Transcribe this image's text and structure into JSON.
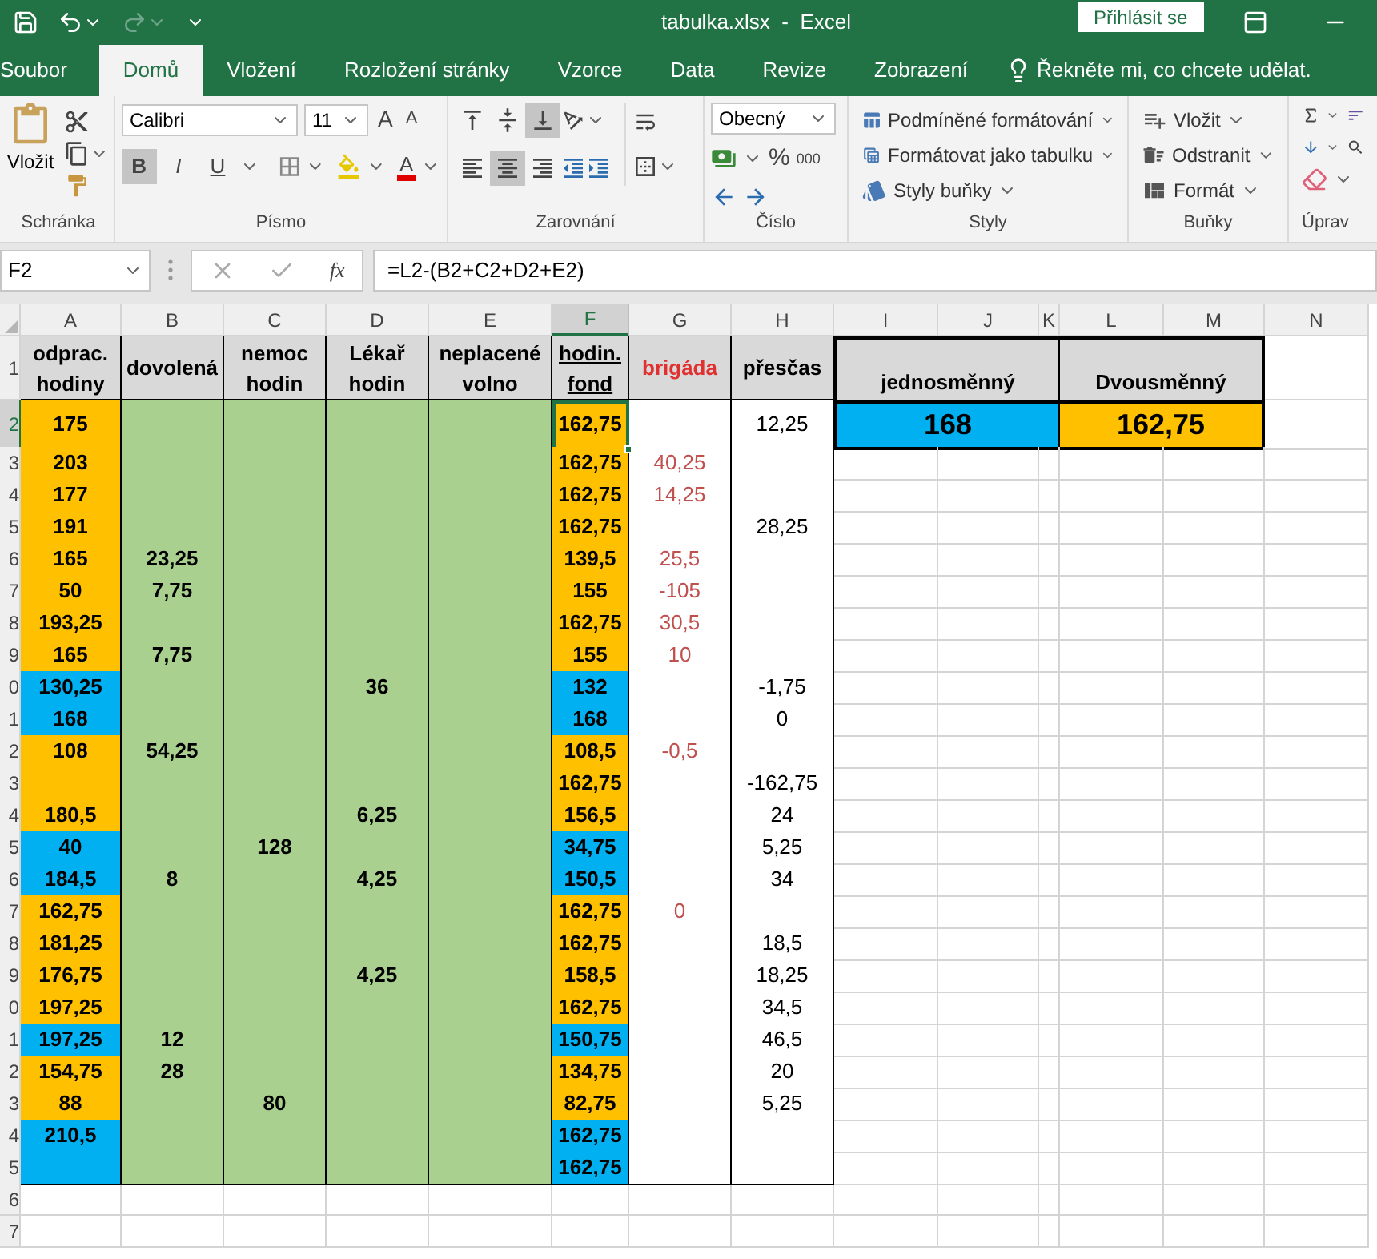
{
  "title_bar": {
    "title": "tabulka.xlsx  -  Excel",
    "sign_in": "Přihlásit se"
  },
  "tabs": [
    {
      "label": "Soubor",
      "selected": false
    },
    {
      "label": "Domů",
      "selected": true
    },
    {
      "label": "Vložení",
      "selected": false
    },
    {
      "label": "Rozložení stránky",
      "selected": false
    },
    {
      "label": "Vzorce",
      "selected": false
    },
    {
      "label": "Data",
      "selected": false
    },
    {
      "label": "Revize",
      "selected": false
    },
    {
      "label": "Zobrazení",
      "selected": false
    }
  ],
  "tell_me": "Řekněte mi, co chcete udělat.",
  "ribbon": {
    "clipboard": {
      "paste": "Vložit",
      "label": "Schránka"
    },
    "font": {
      "name": "Calibri",
      "size": "11",
      "grow": "A",
      "shrink": "A",
      "styles": [
        {
          "label": "B",
          "selected": true
        },
        {
          "label": "I",
          "selected": false
        },
        {
          "label": "U",
          "selected": false
        }
      ],
      "font_color": "A",
      "label": "Písmo"
    },
    "alignment": {
      "vertical": [
        {
          "kind": "top",
          "selected": false
        },
        {
          "kind": "middle",
          "selected": false
        },
        {
          "kind": "bottom",
          "selected": true
        }
      ],
      "horizontal": [
        {
          "kind": "left",
          "selected": false
        },
        {
          "kind": "center",
          "selected": true
        },
        {
          "kind": "right",
          "selected": false
        }
      ],
      "label": "Zarovnání"
    },
    "number": {
      "format": "Obecný",
      "percent": "%",
      "thousands": "000",
      "label": "Číslo"
    },
    "styles": {
      "items": [
        "Podmíněné formátování",
        "Formátovat jako tabulku",
        "Styly buňky"
      ],
      "label": "Styly"
    },
    "cells": {
      "items": [
        "Vložit",
        "Odstranit",
        "Formát"
      ],
      "label": "Buňky"
    },
    "editing": {
      "label": "Úprav"
    }
  },
  "formula_bar": {
    "name_box": "F2",
    "function_button": "fx",
    "formula": "=L2-(B2+C2+D2+E2)"
  },
  "columns": [
    {
      "label": "A",
      "selected": false
    },
    {
      "label": "B",
      "selected": false
    },
    {
      "label": "C",
      "selected": false
    },
    {
      "label": "D",
      "selected": false
    },
    {
      "label": "E",
      "selected": false
    },
    {
      "label": "F",
      "selected": true
    },
    {
      "label": "G",
      "selected": false
    },
    {
      "label": "H",
      "selected": false
    },
    {
      "label": "I",
      "selected": false
    },
    {
      "label": "J",
      "selected": false
    },
    {
      "label": "K",
      "selected": false
    },
    {
      "label": "L",
      "selected": false
    },
    {
      "label": "M",
      "selected": false
    },
    {
      "label": "N",
      "selected": false
    }
  ],
  "header_row": {
    "num": "1",
    "cells": [
      "odprac. hodiny",
      "dovolená",
      "nemoc hodin",
      "Lékař hodin",
      "neplacené volno",
      "hodin. fond",
      "brigáda",
      "přesčas"
    ]
  },
  "shift_table": {
    "labels": [
      "jednosměnný",
      "Dvousměnný"
    ],
    "values": [
      {
        "text": "168",
        "color": "#00b0f0"
      },
      {
        "text": "162,75",
        "color": "#ffc000"
      }
    ]
  },
  "rows": [
    {
      "num": "2",
      "selected": true,
      "a": "175",
      "f": "162,75",
      "h": "12,25",
      "color": "#ffc000"
    },
    {
      "num": "3",
      "selected": false,
      "a": "203",
      "f": "162,75",
      "g": "40,25",
      "color": "#ffc000"
    },
    {
      "num": "4",
      "selected": false,
      "a": "177",
      "f": "162,75",
      "g": "14,25",
      "color": "#ffc000"
    },
    {
      "num": "5",
      "selected": false,
      "a": "191",
      "f": "162,75",
      "h": "28,25",
      "color": "#ffc000"
    },
    {
      "num": "6",
      "selected": false,
      "a": "165",
      "b": "23,25",
      "f": "139,5",
      "g": "25,5",
      "color": "#ffc000"
    },
    {
      "num": "7",
      "selected": false,
      "a": "50",
      "b": "7,75",
      "f": "155",
      "g": "-105",
      "color": "#ffc000"
    },
    {
      "num": "8",
      "selected": false,
      "a": "193,25",
      "f": "162,75",
      "g": "30,5",
      "color": "#ffc000"
    },
    {
      "num": "9",
      "selected": false,
      "a": "165",
      "b": "7,75",
      "f": "155",
      "g": "10",
      "color": "#ffc000"
    },
    {
      "num": "0",
      "selected": false,
      "a": "130,25",
      "d": "36",
      "f": "132",
      "h": "-1,75",
      "color": "#00b0f0"
    },
    {
      "num": "1",
      "selected": false,
      "a": "168",
      "f": "168",
      "h": "0",
      "color": "#00b0f0"
    },
    {
      "num": "2",
      "selected": false,
      "a": "108",
      "b": "54,25",
      "f": "108,5",
      "g": "-0,5",
      "color": "#ffc000"
    },
    {
      "num": "3",
      "selected": false,
      "f": "162,75",
      "h": "-162,75",
      "color": "#ffc000"
    },
    {
      "num": "4",
      "selected": false,
      "a": "180,5",
      "d": "6,25",
      "f": "156,5",
      "h": "24",
      "color": "#ffc000"
    },
    {
      "num": "5",
      "selected": false,
      "a": "40",
      "c": "128",
      "f": "34,75",
      "h": "5,25",
      "color": "#00b0f0"
    },
    {
      "num": "6",
      "selected": false,
      "a": "184,5",
      "b": "8",
      "d": "4,25",
      "f": "150,5",
      "h": "34",
      "color": "#00b0f0"
    },
    {
      "num": "7",
      "selected": false,
      "a": "162,75",
      "f": "162,75",
      "g": "0",
      "color": "#ffc000"
    },
    {
      "num": "8",
      "selected": false,
      "a": "181,25",
      "f": "162,75",
      "h": "18,5",
      "color": "#ffc000"
    },
    {
      "num": "9",
      "selected": false,
      "a": "176,75",
      "d": "4,25",
      "f": "158,5",
      "h": "18,25",
      "color": "#ffc000"
    },
    {
      "num": "0",
      "selected": false,
      "a": "197,25",
      "f": "162,75",
      "h": "34,5",
      "color": "#ffc000"
    },
    {
      "num": "1",
      "selected": false,
      "a": "197,25",
      "b": "12",
      "f": "150,75",
      "h": "46,5",
      "color": "#00b0f0"
    },
    {
      "num": "2",
      "selected": false,
      "a": "154,75",
      "b": "28",
      "f": "134,75",
      "h": "20",
      "color": "#ffc000"
    },
    {
      "num": "3",
      "selected": false,
      "a": "88",
      "c": "80",
      "f": "82,75",
      "h": "5,25",
      "color": "#ffc000"
    },
    {
      "num": "4",
      "selected": false,
      "a": "210,5",
      "f": "162,75",
      "color": "#00b0f0"
    },
    {
      "num": "5",
      "selected": false,
      "f": "162,75",
      "color": "#00b0f0"
    }
  ],
  "empty_rows": [
    "6",
    "7"
  ]
}
